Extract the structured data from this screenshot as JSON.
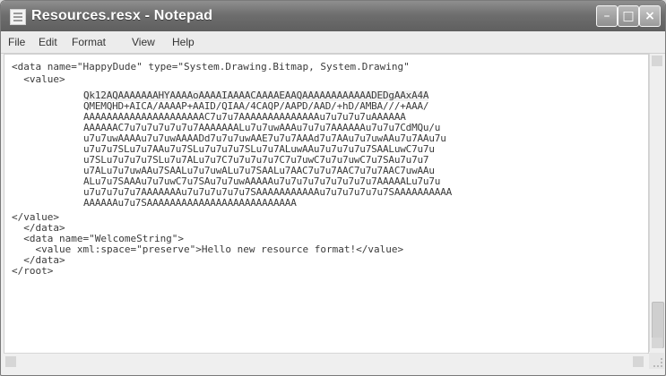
{
  "window": {
    "title": "Resources.resx - Notepad",
    "buttons": {
      "minimize": "–",
      "maximize": "□",
      "close": "×"
    }
  },
  "menu": [
    "File",
    "Edit",
    "Format",
    "View",
    "Help"
  ],
  "editor": {
    "lines": [
      "<data name=\"HappyDude\" type=\"System.Drawing.Bitmap, System.Drawing\"",
      "  <value>",
      "Qk12AQAAAAAAAHYAAAAoAAAAIAAAACAAAAEAAQAAAAAAAAAAAADEDgAAxA4A",
      "QMEMQHD+AICA/AAAAP+AAID/QIAA/4CAQP/AAPD/AAD/+hD/AMBA///+AAA/",
      "AAAAAAAAAAAAAAAAAAAAAC7u7u7AAAAAAAAAAAAAAu7u7u7u7uAAAAAA",
      "AAAAAAC7u7u7u7u7u7u7AAAAAAALu7u7uwAAAu7u7u7AAAAAAu7u7u7CdMQu/u",
      "u7u7uwAAAAu7u7uwAAAADd7u7u7uwAAE7u7u7AAAd7u7AAu7u7uwAAu7u7AAu7u",
      "u7u7u7SLu7u7AAu7u7SLu7u7u7u7SLu7u7ALuwAAu7u7u7u7u7SAALuwC7u7u",
      "u7SLu7u7u7u7SLu7u7ALu7u7C7u7u7u7u7C7u7uwC7u7u7uwC7u7SAu7u7u7",
      "u7ALu7u7uwAAu7SAALu7u7uwALu7u7SAALu7AAC7u7u7AAC7u7u7AAC7uwAAu",
      "ALu7u7SAAAu7u7uwC7u7SAu7u7uwAAAAAu7u7u7u7u7u7u7u7u7AAAAALu7u7u",
      "u7u7u7u7u7AAAAAAAu7u7u7u7u7u7SAAAAAAAAAAAu7u7u7u7u7u7SAAAAAAAAAA",
      "AAAAAAu7u7SAAAAAAAAAAAAAAAAAAAAAAAAAA",
      "</value>",
      "  </data>",
      "  <data name=\"WelcomeString\">",
      "    <value xml:space=\"preserve\">Hello new resource format!</value>",
      "  </data>",
      "</root>"
    ]
  }
}
